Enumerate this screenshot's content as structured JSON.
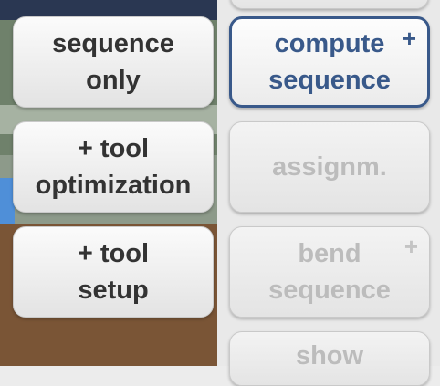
{
  "left_buttons": [
    {
      "label": "sequence\nonly"
    },
    {
      "label": "+ tool\noptimization"
    },
    {
      "label": "+ tool\nsetup"
    }
  ],
  "right_buttons": [
    {
      "label": "compute\nsequence",
      "plus": "+",
      "state": "active"
    },
    {
      "label": "assignm.",
      "state": "disabled"
    },
    {
      "label": "bend\nsequence",
      "plus": "+",
      "state": "disabled"
    },
    {
      "label": "show",
      "state": "disabled"
    }
  ],
  "colors": {
    "active_border": "#39598a",
    "disabled_text": "#bcbcbc",
    "normal_text": "#333333"
  }
}
